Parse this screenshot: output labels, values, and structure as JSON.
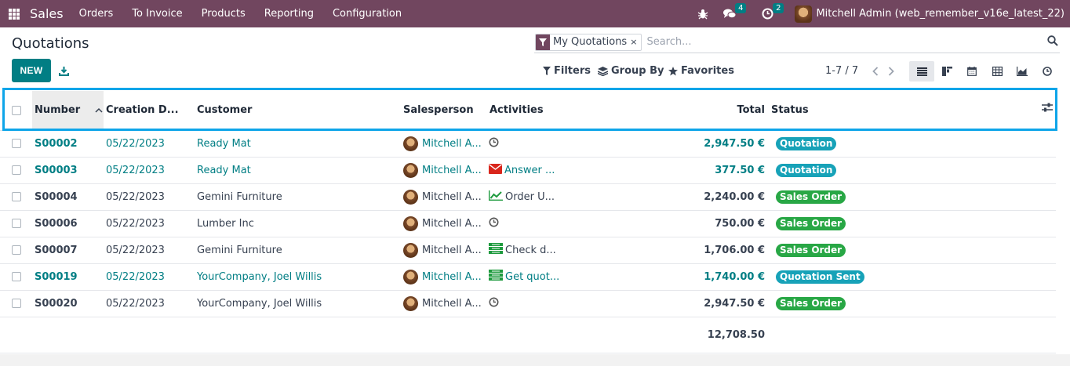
{
  "navbar": {
    "app_name": "Sales",
    "menu": [
      "Orders",
      "To Invoice",
      "Products",
      "Reporting",
      "Configuration"
    ],
    "messages_count": "4",
    "activities_count": "2",
    "user": "Mitchell Admin (web_remember_v16e_latest_22)"
  },
  "control_panel": {
    "title": "Quotations",
    "new_label": "NEW",
    "search": {
      "facet_label": "My Quotations",
      "facet_close": "×",
      "placeholder": "Search..."
    },
    "filters_label": "Filters",
    "group_by_label": "Group By",
    "favorites_label": "Favorites",
    "pager": "1-7 / 7"
  },
  "table": {
    "columns": [
      "Number",
      "Creation D...",
      "Customer",
      "Salesperson",
      "Activities",
      "Total",
      "Status"
    ],
    "rows": [
      {
        "number": "S00002",
        "date": "05/22/2023",
        "customer": "Ready Mat",
        "salesperson": "Mitchell A...",
        "activity_icon": "clock-icon",
        "activity": "",
        "total": "2,947.50 €",
        "status": "Quotation",
        "status_kind": "quotation",
        "highlight": true
      },
      {
        "number": "S00003",
        "date": "05/22/2023",
        "customer": "Ready Mat",
        "salesperson": "Mitchell A...",
        "activity_icon": "envelope-icon",
        "activity": "Answer ...",
        "total": "377.50 €",
        "status": "Quotation",
        "status_kind": "quotation",
        "highlight": true
      },
      {
        "number": "S00004",
        "date": "05/22/2023",
        "customer": "Gemini Furniture",
        "salesperson": "Mitchell A...",
        "activity_icon": "chart-line-icon",
        "activity": "Order U...",
        "total": "2,240.00 €",
        "status": "Sales Order",
        "status_kind": "sale",
        "highlight": false
      },
      {
        "number": "S00006",
        "date": "05/22/2023",
        "customer": "Lumber Inc",
        "salesperson": "Mitchell A...",
        "activity_icon": "clock-icon",
        "activity": "",
        "total": "750.00 €",
        "status": "Sales Order",
        "status_kind": "sale",
        "highlight": false
      },
      {
        "number": "S00007",
        "date": "05/22/2023",
        "customer": "Gemini Furniture",
        "salesperson": "Mitchell A...",
        "activity_icon": "list-icon",
        "activity": "Check d...",
        "total": "1,706.00 €",
        "status": "Sales Order",
        "status_kind": "sale",
        "highlight": false
      },
      {
        "number": "S00019",
        "date": "05/22/2023",
        "customer": "YourCompany, Joel Willis",
        "salesperson": "Mitchell A...",
        "activity_icon": "list-icon",
        "activity": "Get quot...",
        "total": "1,740.00 €",
        "status": "Quotation Sent",
        "status_kind": "sent",
        "highlight": true
      },
      {
        "number": "S00020",
        "date": "05/22/2023",
        "customer": "YourCompany, Joel Willis",
        "salesperson": "Mitchell A...",
        "activity_icon": "clock-icon",
        "activity": "",
        "total": "2,947.50 €",
        "status": "Sales Order",
        "status_kind": "sale",
        "highlight": false
      }
    ],
    "grand_total": "12,708.50"
  },
  "colors": {
    "navbar": "#71465f",
    "primary": "#017e84",
    "quotation_badge": "#17a2b8",
    "sales_order_badge": "#28a745",
    "highlight_outline": "#0ea5e9"
  }
}
